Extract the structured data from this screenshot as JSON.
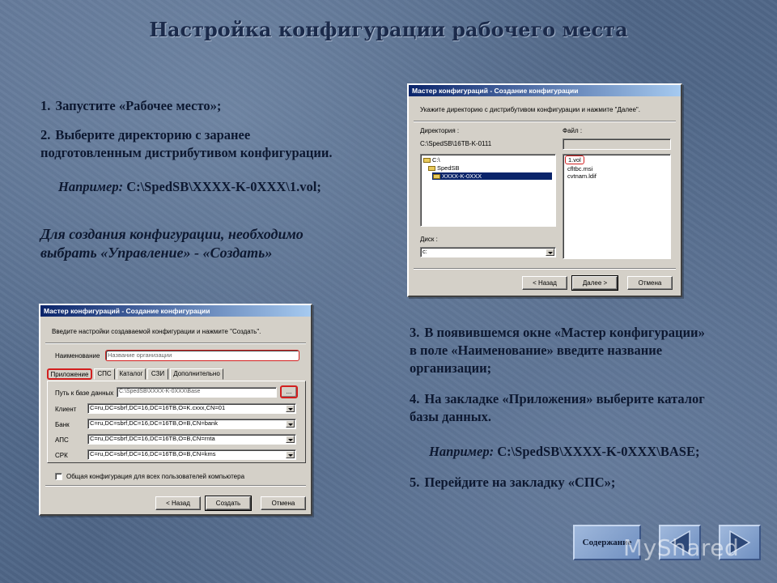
{
  "slide": {
    "title": "Настройка конфигурации рабочего места",
    "step1_num": "1.",
    "step1": "Запустите «Рабочее место»;",
    "step2_num": "2.",
    "step2_line1": "Выберите директорию с заранее",
    "step2_line2": "подготовленным дистрибутивом конфигурации.",
    "example1_label": "Например:",
    "example1_value": " C:\\SpedSB\\XXXX-K-0XXX\\1.vol;",
    "callout_line1": "Для создания конфигурации, необходимо",
    "callout_line2": "выбрать «Управление» - «Создать»",
    "step3_num": "3.",
    "step3_line1": "В появившемся окне «Мастер конфигурации»",
    "step3_line2": "в поле «Наименование» введите название",
    "step3_line3": "организации;",
    "step4_num": "4.",
    "step4_line1": "На закладке «Приложения» выберите каталог",
    "step4_line2": "базы данных.",
    "example2_label": "Например:",
    "example2_value": " C:\\SpedSB\\XXXX-K-0XXX\\BASE;",
    "step5_num": "5.",
    "step5": "Перейдите на закладку «СПС»;"
  },
  "wizard_dir": {
    "title": "Мастер конфигураций - Создание конфигурации",
    "instruction": "Укажите директорию с дистрибутивом конфигурации и нажмите \"Далее\".",
    "dir_label": "Директория :",
    "dir_path": "C:\\SpedSB\\16TB-K-0111",
    "file_label": "Файл :",
    "tree": [
      "C:\\",
      "SpedSB",
      "XXXX-K-0XXX"
    ],
    "files": [
      "1.vol",
      "cfltbc.msi",
      "cvtnam.ldif"
    ],
    "disk_label": "Диск :",
    "disk_value": "c:",
    "back_button": "< Назад",
    "next_button": "Далее >",
    "cancel_button": "Отмена"
  },
  "wizard_create": {
    "title": "Мастер конфигураций - Создание конфигурации",
    "instruction": "Введите настройки создаваемой конфигурации и нажмите \"Создать\".",
    "name_label": "Наименование",
    "name_value": "Название организации",
    "tabs": [
      "Приложение",
      "СПС",
      "Каталог",
      "СЗИ",
      "Дополнительно"
    ],
    "db_path_label": "Путь к базе данных",
    "db_path_value": "C:\\SpedSB\\XXXX-K-0XXX\\Base",
    "browse_button": "...",
    "rows": [
      {
        "label": "Клиент",
        "value": "C=ru,DC=sbrf,DC=16,DC=16TB,O=K.cxxx,CN=01"
      },
      {
        "label": "Банк",
        "value": "C=ru,DC=sbrf,DC=16,DC=16TB,O=B,CN=bank"
      },
      {
        "label": "АПС",
        "value": "C=ru,DC=sbrf,DC=16,DC=16TB,O=B,CN=rnta"
      },
      {
        "label": "СРК",
        "value": "C=ru,DC=sbrf,DC=16,DC=16TB,O=B,CN=kms"
      }
    ],
    "shared_checkbox": "Общая конфигурация для всех пользователей компьютера",
    "back_button": "< Назад",
    "create_button": "Создать",
    "cancel_button": "Отмена"
  },
  "nav": {
    "contents_button": "Содержание",
    "watermark": "MyShared"
  }
}
